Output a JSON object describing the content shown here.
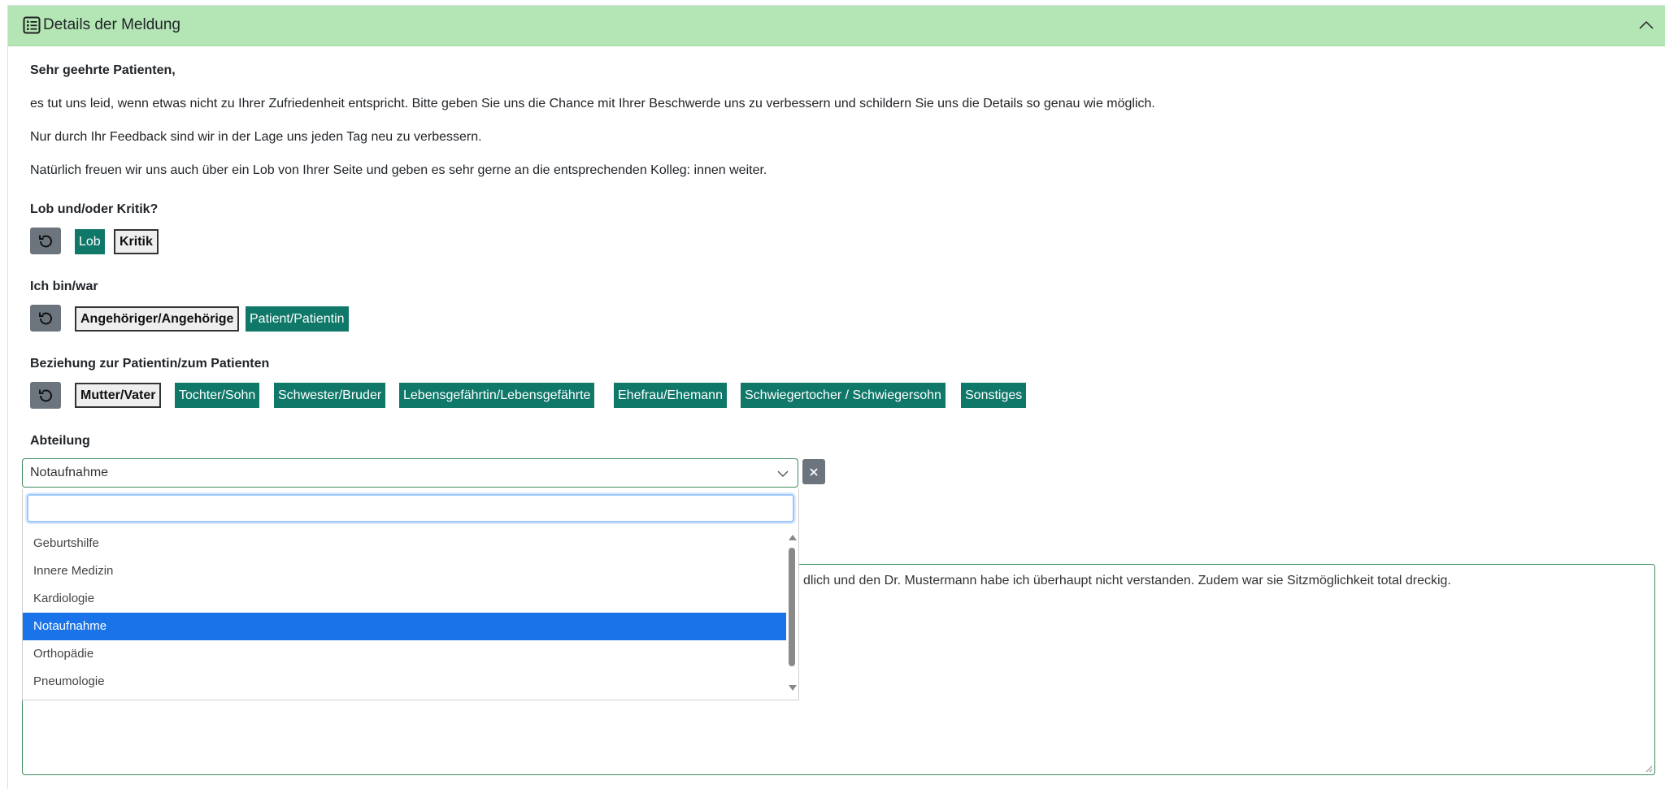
{
  "header": {
    "icon": "list-icon",
    "title": "Details der Meldung",
    "collapse_icon": "chevron-up-icon"
  },
  "intro": {
    "greeting": "Sehr geehrte Patienten,",
    "p1": "es tut uns leid, wenn etwas nicht zu Ihrer Zufriedenheit entspricht. Bitte geben Sie uns die Chance mit Ihrer Beschwerde uns zu verbessern und schildern Sie uns die Details so genau wie möglich.",
    "p2": "Nur durch Ihr Feedback sind wir in der Lage uns jeden Tag neu zu verbessern.",
    "p3": "Natürlich freuen wir uns auch über ein Lob von Ihrer Seite und geben es sehr gerne an die entsprechenden Kolleg: innen weiter."
  },
  "q_type": {
    "label": "Lob und/oder Kritik?",
    "options": [
      "Lob",
      "Kritik"
    ],
    "selected": "Kritik"
  },
  "q_role": {
    "label": "Ich bin/war",
    "options": [
      "Angehöriger/Angehörige",
      "Patient/Patientin"
    ],
    "selected": "Angehöriger/Angehörige"
  },
  "q_relation": {
    "label": "Beziehung zur Patientin/zum Patienten",
    "options": [
      "Mutter/Vater",
      "Tochter/Sohn",
      "Schwester/Bruder",
      "Lebensgefährtin/Lebensgefährte",
      "Ehefrau/Ehemann",
      "Schwiegertocher / Schwiegersohn",
      "Sonstiges"
    ],
    "selected": "Mutter/Vater"
  },
  "department": {
    "label": "Abteilung",
    "value": "Notaufnahme",
    "search_value": "",
    "options": [
      "Geburtshilfe",
      "Innere Medizin",
      "Kardiologie",
      "Notaufnahme",
      "Orthopädie",
      "Pneumologie"
    ],
    "highlighted": "Notaufnahme"
  },
  "description": {
    "visible_text": "dlich und den Dr. Mustermann habe ich überhaupt nicht verstanden. Zudem war sie Sitzmöglichkeit total dreckig."
  },
  "colors": {
    "header_bg": "#b4e5b4",
    "option_teal": "#107869",
    "reset_gray": "#6c757d",
    "highlight_blue": "#1a73e8"
  }
}
